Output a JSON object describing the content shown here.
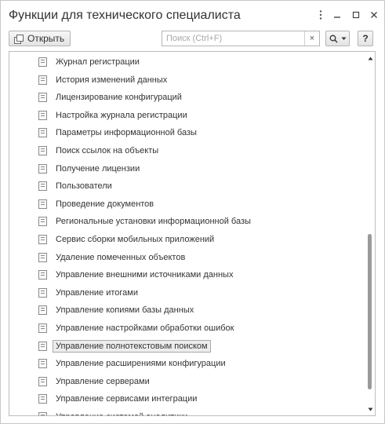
{
  "window": {
    "title": "Функции для технического специалиста",
    "menu_icon": "more-vertical-icon",
    "minimize_icon": "minimize-icon",
    "maximize_icon": "maximize-icon",
    "close_icon": "close-icon"
  },
  "toolbar": {
    "open_label": "Открыть",
    "search_placeholder": "Поиск (Ctrl+F)",
    "search_value": "",
    "clear_symbol": "×",
    "search_button_symbol": "🔍▾",
    "help_label": "?"
  },
  "list": {
    "items": [
      {
        "label": "Журнал регистрации"
      },
      {
        "label": "История изменений данных"
      },
      {
        "label": "Лицензирование конфигураций"
      },
      {
        "label": "Настройка журнала регистрации"
      },
      {
        "label": "Параметры информационной базы"
      },
      {
        "label": "Поиск ссылок на объекты"
      },
      {
        "label": "Получение лицензии"
      },
      {
        "label": "Пользователи"
      },
      {
        "label": "Проведение документов"
      },
      {
        "label": "Региональные установки информационной базы"
      },
      {
        "label": "Сервис сборки мобильных приложений"
      },
      {
        "label": "Удаление помеченных объектов"
      },
      {
        "label": "Управление внешними источниками данных"
      },
      {
        "label": "Управление итогами"
      },
      {
        "label": "Управление копиями базы данных"
      },
      {
        "label": "Управление настройками обработки ошибок"
      },
      {
        "label": "Управление полнотекстовым поиском",
        "selected": true
      },
      {
        "label": "Управление расширениями конфигурации"
      },
      {
        "label": "Управление серверами"
      },
      {
        "label": "Управление сервисами интеграции"
      },
      {
        "label": "Управление системой аналитики"
      }
    ],
    "scroll_position": 0.85
  }
}
